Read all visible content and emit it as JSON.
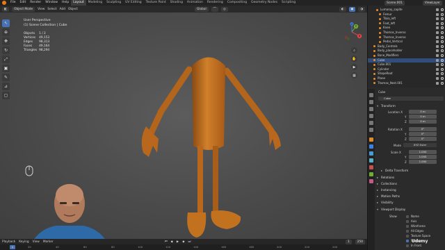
{
  "topbar": {
    "menus": [
      "File",
      "Edit",
      "Render",
      "Window",
      "Help"
    ],
    "workspaces": [
      "Layout",
      "Modeling",
      "Sculpting",
      "UV Editing",
      "Texture Paint",
      "Shading",
      "Animation",
      "Rendering",
      "Compositing",
      "Geometry Nodes",
      "Scripting"
    ],
    "active_workspace": "Layout",
    "scene": "Scene.001",
    "view_layer": "ViewLayer"
  },
  "viewport_header": {
    "mode": "Object Mode",
    "menus": [
      "View",
      "Select",
      "Add",
      "Object"
    ],
    "transform": "Global"
  },
  "overlay": {
    "view_name": "User Perspective",
    "collection_path": "(1) Scene Collection | Cube",
    "stats": [
      {
        "label": "Objects",
        "value": "1 / 2"
      },
      {
        "label": "Vertices",
        "value": "49,153"
      },
      {
        "label": "Edges",
        "value": "98,313"
      },
      {
        "label": "Faces",
        "value": "49,164"
      },
      {
        "label": "Triangles",
        "value": "98,294"
      }
    ]
  },
  "gizmo": {
    "x": "X",
    "y": "Y",
    "z": "Z"
  },
  "timeline": {
    "menus": [
      "Playback",
      "Keying",
      "View",
      "Marker"
    ],
    "current_frame": "1",
    "ticks": [
      "20",
      "40",
      "60",
      "80",
      "100",
      "120",
      "140",
      "160",
      "180",
      "200",
      "220",
      "240"
    ],
    "start": "1",
    "end": "250"
  },
  "outliner": {
    "items": [
      {
        "name": "Lumaroy_sapite",
        "indent": 3
      },
      {
        "name": "Femur",
        "indent": 4
      },
      {
        "name": "Tibia_left",
        "indent": 4
      },
      {
        "name": "Foot_left",
        "indent": 4
      },
      {
        "name": "Knee",
        "indent": 4
      },
      {
        "name": "Thomas_Inverso",
        "indent": 4
      },
      {
        "name": "Thomas_Inverso",
        "indent": 4
      },
      {
        "name": "Pedal_Vertical",
        "indent": 4
      },
      {
        "name": "Body_Controls",
        "indent": 2
      },
      {
        "name": "Body_placeholder",
        "indent": 2
      },
      {
        "name": "Bone_Modifiers",
        "indent": 2
      },
      {
        "name": "Cube",
        "indent": 2
      },
      {
        "name": "Cube.001",
        "indent": 2
      },
      {
        "name": "Cylinder",
        "indent": 2
      },
      {
        "name": "ShapeRoot",
        "indent": 2
      },
      {
        "name": "Plane",
        "indent": 2
      },
      {
        "name": "Thomas_Nest.001",
        "indent": 2
      }
    ],
    "selected": "Cube"
  },
  "properties": {
    "object_name": "Cube",
    "data_name": "Cube",
    "transform_title": "Transform",
    "location_label": "Location X",
    "location": [
      "0 m",
      "0 m",
      "0 m"
    ],
    "rotation_label": "Rotation X",
    "rotation": [
      "0°",
      "0°",
      "0°"
    ],
    "mode_label": "Mode",
    "mode_value": "XYZ Euler",
    "scale_label": "Scale X",
    "scale": [
      "1.000",
      "1.000",
      "1.000"
    ],
    "axis_y": "Y",
    "axis_z": "Z",
    "sections": [
      "Delta Transform",
      "Relations",
      "Collections",
      "Instancing",
      "Motion Paths",
      "Visibility"
    ],
    "viewport_display_title": "Viewport Display",
    "show_label": "Show",
    "show_options": [
      {
        "label": "Name",
        "on": false
      },
      {
        "label": "Axis",
        "on": false
      },
      {
        "label": "Wireframe",
        "on": false
      },
      {
        "label": "All Edges",
        "on": false
      },
      {
        "label": "Texture Space",
        "on": false
      },
      {
        "label": "Shadow",
        "on": true
      },
      {
        "label": "In Front",
        "on": false
      }
    ]
  },
  "watermark": "Udemy",
  "colors": {
    "accent": "#4772b3",
    "object": "#c7701f",
    "selection": "#334d7a"
  }
}
